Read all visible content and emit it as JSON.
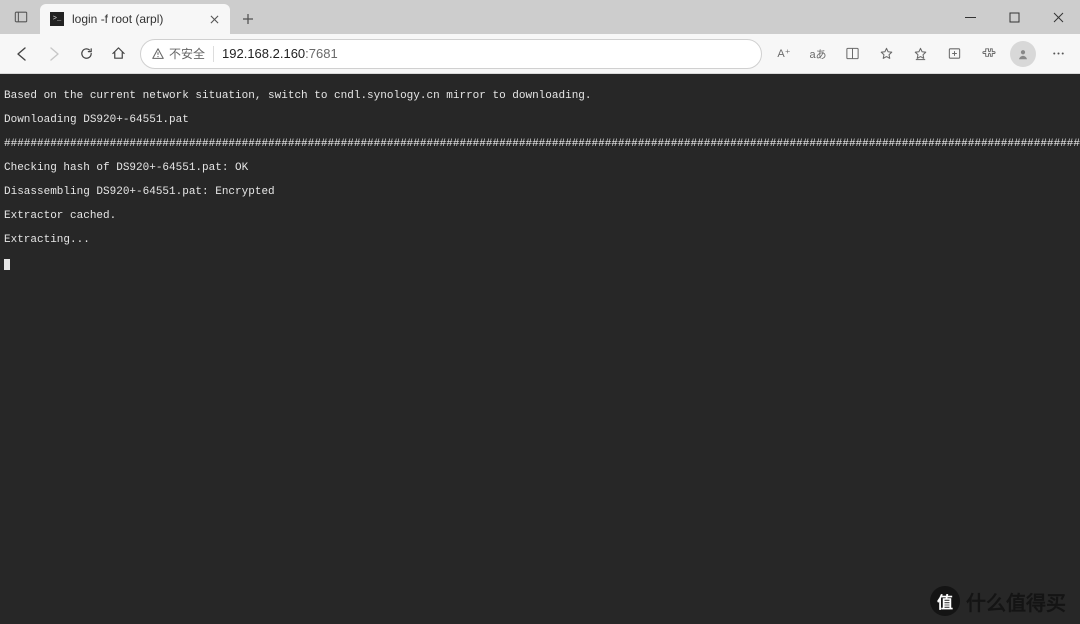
{
  "browser": {
    "tab_title": "login -f root (arpl)",
    "security_label": "不安全",
    "url_host": "192.168.2.160",
    "url_port": ":7681",
    "read_aloud": "A⁺",
    "translate": "aあ"
  },
  "terminal": {
    "lines": [
      "Based on the current network situation, switch to cndl.synology.cn mirror to downloading.",
      "Downloading DS920+-64551.pat"
    ],
    "progress_percent": "100.0%",
    "lines2": [
      "Checking hash of DS920+-64551.pat: OK",
      "Disassembling DS920+-64551.pat: Encrypted",
      "Extractor cached.",
      "Extracting..."
    ]
  },
  "watermark": {
    "badge": "值",
    "text": "什么值得买"
  }
}
